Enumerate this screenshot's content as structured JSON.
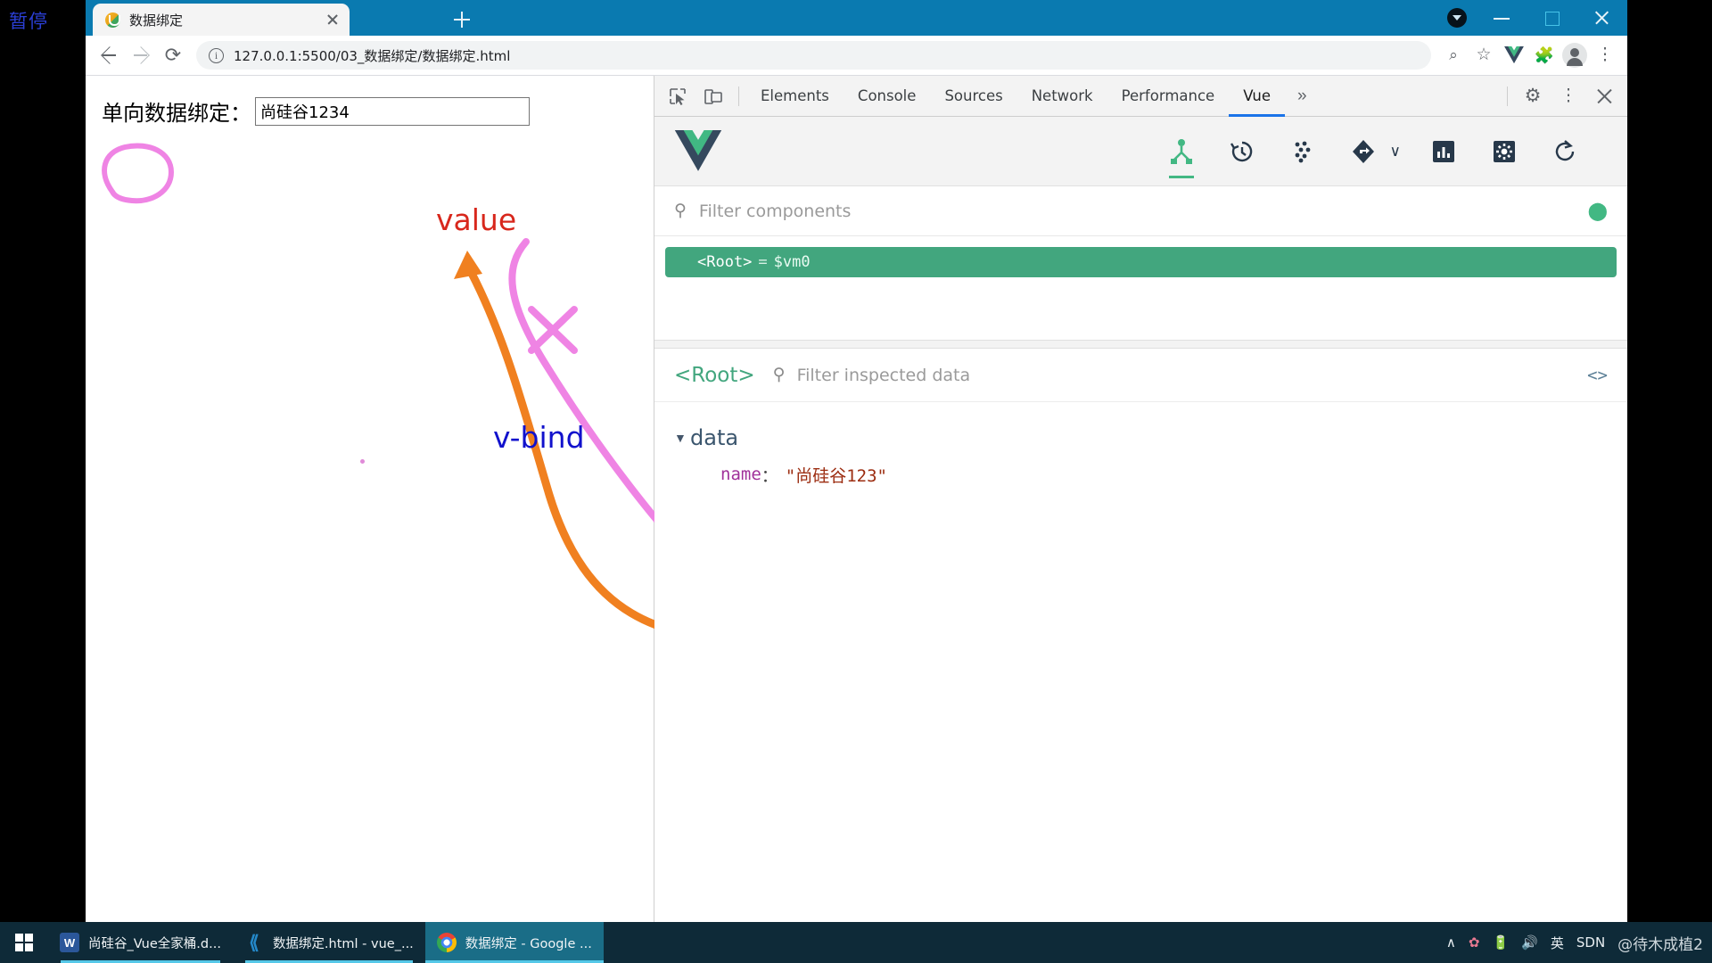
{
  "capture": {
    "label": "暂停"
  },
  "browser": {
    "tab": {
      "title": "数据绑定",
      "favicon": "vue-favicon",
      "close": "×"
    },
    "new_tab": "+",
    "window_controls": {
      "minimize": "−",
      "maximize": "□",
      "close": "×",
      "dropdown": "▼"
    },
    "toolbar": {
      "back": "←",
      "forward": "→",
      "reload": "⟳",
      "info": "ⓘ",
      "url": "127.0.0.1:5500/03_数据绑定/数据绑定.html",
      "zoom": "⊕",
      "bookmark": "☆",
      "vue_extension": "V",
      "extensions": "🧩",
      "profile": "avatar",
      "menu": "⋮"
    }
  },
  "webpage": {
    "label": "单向数据绑定：",
    "input_value": "尚硅谷1234"
  },
  "annotations": {
    "value": "value",
    "v_bind": "v-bind"
  },
  "devtools": {
    "inspect_icon": "inspect-element-icon",
    "device_icon": "device-toolbar-icon",
    "tabs": [
      {
        "label": "Elements",
        "active": false
      },
      {
        "label": "Console",
        "active": false
      },
      {
        "label": "Sources",
        "active": false
      },
      {
        "label": "Network",
        "active": false
      },
      {
        "label": "Performance",
        "active": false
      },
      {
        "label": "Vue",
        "active": true
      }
    ],
    "more_tabs": "»",
    "settings": "⚙",
    "kebab": "⋮",
    "close": "×"
  },
  "vue_devtools": {
    "logo": "vue-logo",
    "tools": [
      {
        "name": "components-icon",
        "active": true
      },
      {
        "name": "timeline-icon",
        "active": false
      },
      {
        "name": "pinia-icon",
        "active": false
      },
      {
        "name": "router-icon",
        "active": false
      },
      {
        "name": "router-chevron-icon",
        "active": false
      },
      {
        "name": "performance-icon",
        "active": false
      },
      {
        "name": "settings-icon",
        "active": false
      },
      {
        "name": "refresh-icon",
        "active": false
      }
    ],
    "filter": {
      "search_icon": "search-icon",
      "placeholder": "Filter components",
      "select_icon": "select-component-icon"
    },
    "tree": {
      "root_tag": "<Root>",
      "equals": "=",
      "vm": "$vm0"
    },
    "inspector": {
      "root_label": "<Root>",
      "search_icon": "search-icon",
      "placeholder": "Filter inspected data",
      "code_icon": "<>",
      "caret": "▼",
      "group": "data",
      "properties": [
        {
          "name": "name",
          "colon": "：",
          "value": "\"尚硅谷123\""
        }
      ]
    }
  },
  "taskbar": {
    "start": "windows-logo",
    "items": [
      {
        "label": "尚硅谷_Vue全家桶.d...",
        "icon": "word-icon",
        "state": "open"
      },
      {
        "label": "数据绑定.html - vue_...",
        "icon": "vscode-icon",
        "state": "open"
      },
      {
        "label": "数据绑定 - Google ...",
        "icon": "chrome-icon",
        "state": "active"
      }
    ],
    "tray": {
      "overflow": "∧",
      "app": "✿",
      "battery": "🔋",
      "volume": "🔊",
      "ime": "英",
      "csdn": "SDN",
      "watermark": "@待木成植2"
    }
  },
  "colors": {
    "chrome_tabstrip": "#0a7ab0",
    "vue_green": "#42b883",
    "devtools_active": "#1a73e8",
    "annot_value": "#d8271c",
    "annot_vbind": "#1111cc",
    "arrow_orange": "#f08020",
    "arrow_pink": "#ef84e4"
  }
}
